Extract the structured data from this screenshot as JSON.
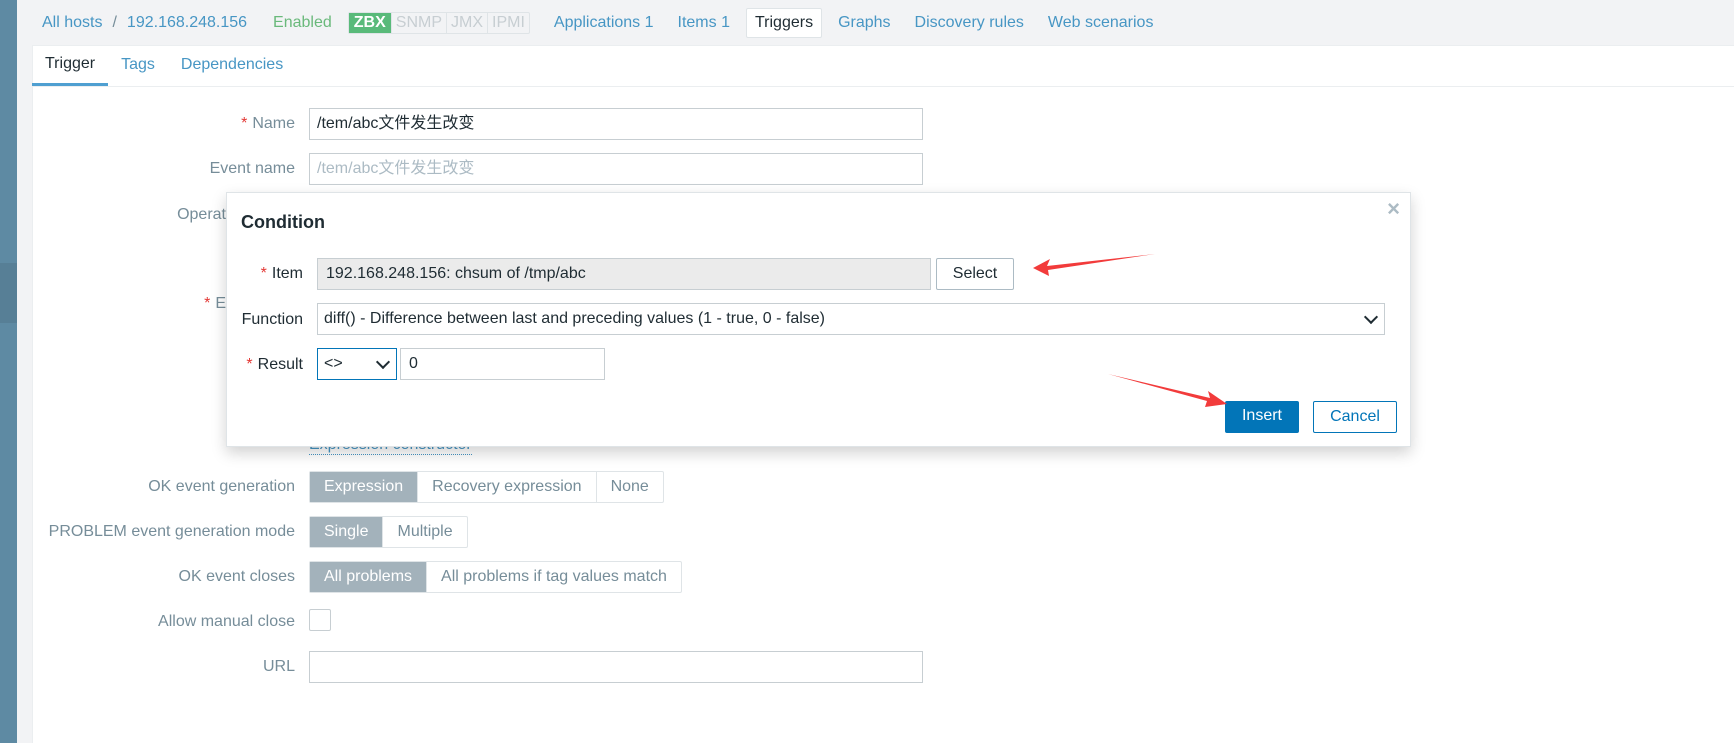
{
  "breadcrumb": {
    "all_hosts": "All hosts",
    "separator": "/",
    "host": "192.168.248.156"
  },
  "status": "Enabled",
  "availability": [
    "ZBX",
    "SNMP",
    "JMX",
    "IPMI"
  ],
  "nav_tabs": [
    "Applications 1",
    "Items 1",
    "Triggers",
    "Graphs",
    "Discovery rules",
    "Web scenarios"
  ],
  "subtabs": [
    "Trigger",
    "Tags",
    "Dependencies"
  ],
  "form": {
    "name_label": "Name",
    "name_value": "/tem/abc文件发生改变",
    "event_name_label": "Event name",
    "event_name_placeholder": "/tem/abc文件发生改变",
    "operational_label": "Operat",
    "expression_label": "E",
    "expression_constructor": "Expression constructor",
    "ok_event_generation_label": "OK event generation",
    "ok_event_generation_options": [
      "Expression",
      "Recovery expression",
      "None"
    ],
    "problem_mode_label": "PROBLEM event generation mode",
    "problem_mode_options": [
      "Single",
      "Multiple"
    ],
    "ok_event_closes_label": "OK event closes",
    "ok_event_closes_options": [
      "All problems",
      "All problems if tag values match"
    ],
    "allow_manual_close_label": "Allow manual close",
    "allow_manual_close_checked": false,
    "url_label": "URL"
  },
  "dialog": {
    "title": "Condition",
    "close": "×",
    "item_label": "Item",
    "item_value": "192.168.248.156: chsum of /tmp/abc",
    "select_button": "Select",
    "function_label": "Function",
    "function_value": "diff() - Difference between last and preceding values (1 - true, 0 - false)",
    "result_label": "Result",
    "result_operator": "<>",
    "result_value": "0",
    "insert_button": "Insert",
    "cancel_button": "Cancel"
  },
  "colors": {
    "accent": "#0275b8",
    "link": "#4796c4",
    "annotation_arrow": "#f23b3b",
    "enabled": "#6ab97b"
  }
}
